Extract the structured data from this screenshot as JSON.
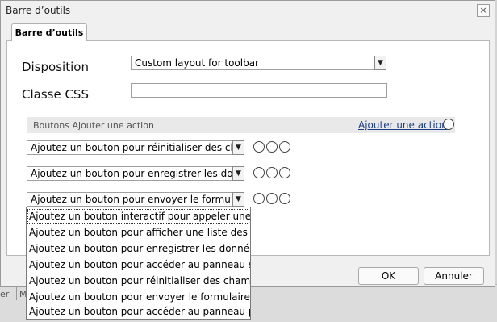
{
  "dialog": {
    "title": "Barre d’outils",
    "close_glyph": "×"
  },
  "tab": {
    "label": "Barre d’outils"
  },
  "form": {
    "layout_label": "Disposition",
    "layout_value": "Custom layout for toolbar",
    "css_label": "Classe CSS",
    "css_value": ""
  },
  "actions": {
    "section_title": "Boutons Ajouter une action",
    "add_link": "Ajouter une action",
    "rows": [
      {
        "value": "Ajoutez un bouton pour réinitialiser des champs"
      },
      {
        "value": "Ajoutez un bouton pour enregistrer les données"
      },
      {
        "value": "Ajoutez un bouton pour envoyer le formulaire."
      }
    ]
  },
  "dropdown": {
    "options": [
      "Ajoutez un bouton interactif pour appeler une act...",
      "Ajoutez un bouton pour afficher une liste des fich...",
      "Ajoutez un bouton pour enregistrer les données ...",
      "Ajoutez un bouton pour accéder au panneau suiv...",
      "Ajoutez un bouton pour réinitialiser des champs ...",
      "Ajoutez un bouton pour envoyer le formulaire.",
      "Ajoutez un bouton pour accéder au panneau pré..."
    ]
  },
  "footer": {
    "ok_label": "OK",
    "cancel_label": "Annuler"
  },
  "background": {
    "text_left": "er",
    "text_right": "M"
  }
}
